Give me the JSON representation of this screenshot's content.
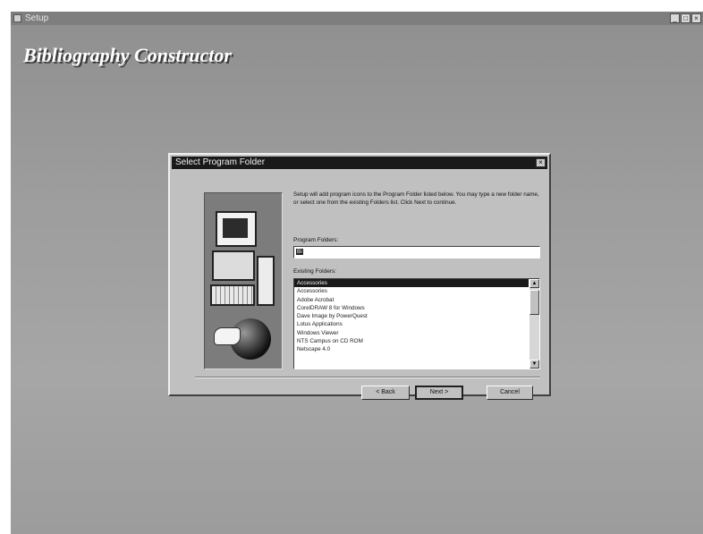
{
  "window": {
    "title": "Setup",
    "controls": [
      "_",
      "□",
      "×"
    ]
  },
  "banner": {
    "title": "Bibliography Constructor"
  },
  "dialog": {
    "title": "Select Program Folder",
    "close_glyph": "×",
    "instructions": "Setup will add program icons to the Program Folder listed below. You may type a new folder name, or select one from the existing Folders list. Click Next to continue.",
    "program_folder_label": "Program Folders:",
    "program_folder_value": "Bi",
    "existing_folders_label": "Existing Folders:",
    "existing_folders": [
      "Accessories",
      "Accessories",
      "Adobe Acrobat",
      "CorelDRAW 8 for Windows",
      "Dave Image by PowerQuest",
      "Lotus Applications",
      "Windows Viewer",
      "NTS Campus on CD ROM",
      "Netscape 4.0"
    ],
    "selected_folder_index": 0,
    "buttons": {
      "back": "< Back",
      "next": "Next >",
      "cancel": "Cancel"
    }
  },
  "icons": {
    "computer_art": "computer-globe-illustration",
    "scroll_up": "▲",
    "scroll_down": "▼"
  }
}
